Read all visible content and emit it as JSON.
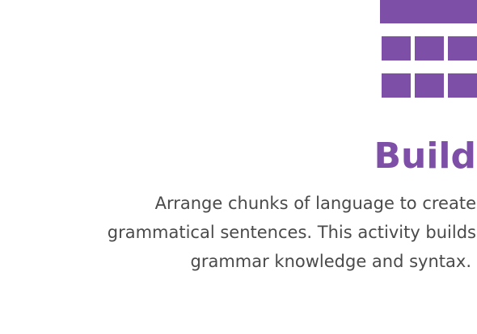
{
  "logo": {
    "icon": "grid-blocks-icon",
    "color": "#7e4fa6"
  },
  "activity": {
    "title": "Build",
    "description_lines": [
      "Arrange chunks of language to create",
      "grammatical sentences. This activity builds",
      "grammar knowledge and syntax."
    ]
  },
  "colors": {
    "accent": "#7e4fa6",
    "text": "#4a4a4a",
    "background": "#ffffff"
  }
}
